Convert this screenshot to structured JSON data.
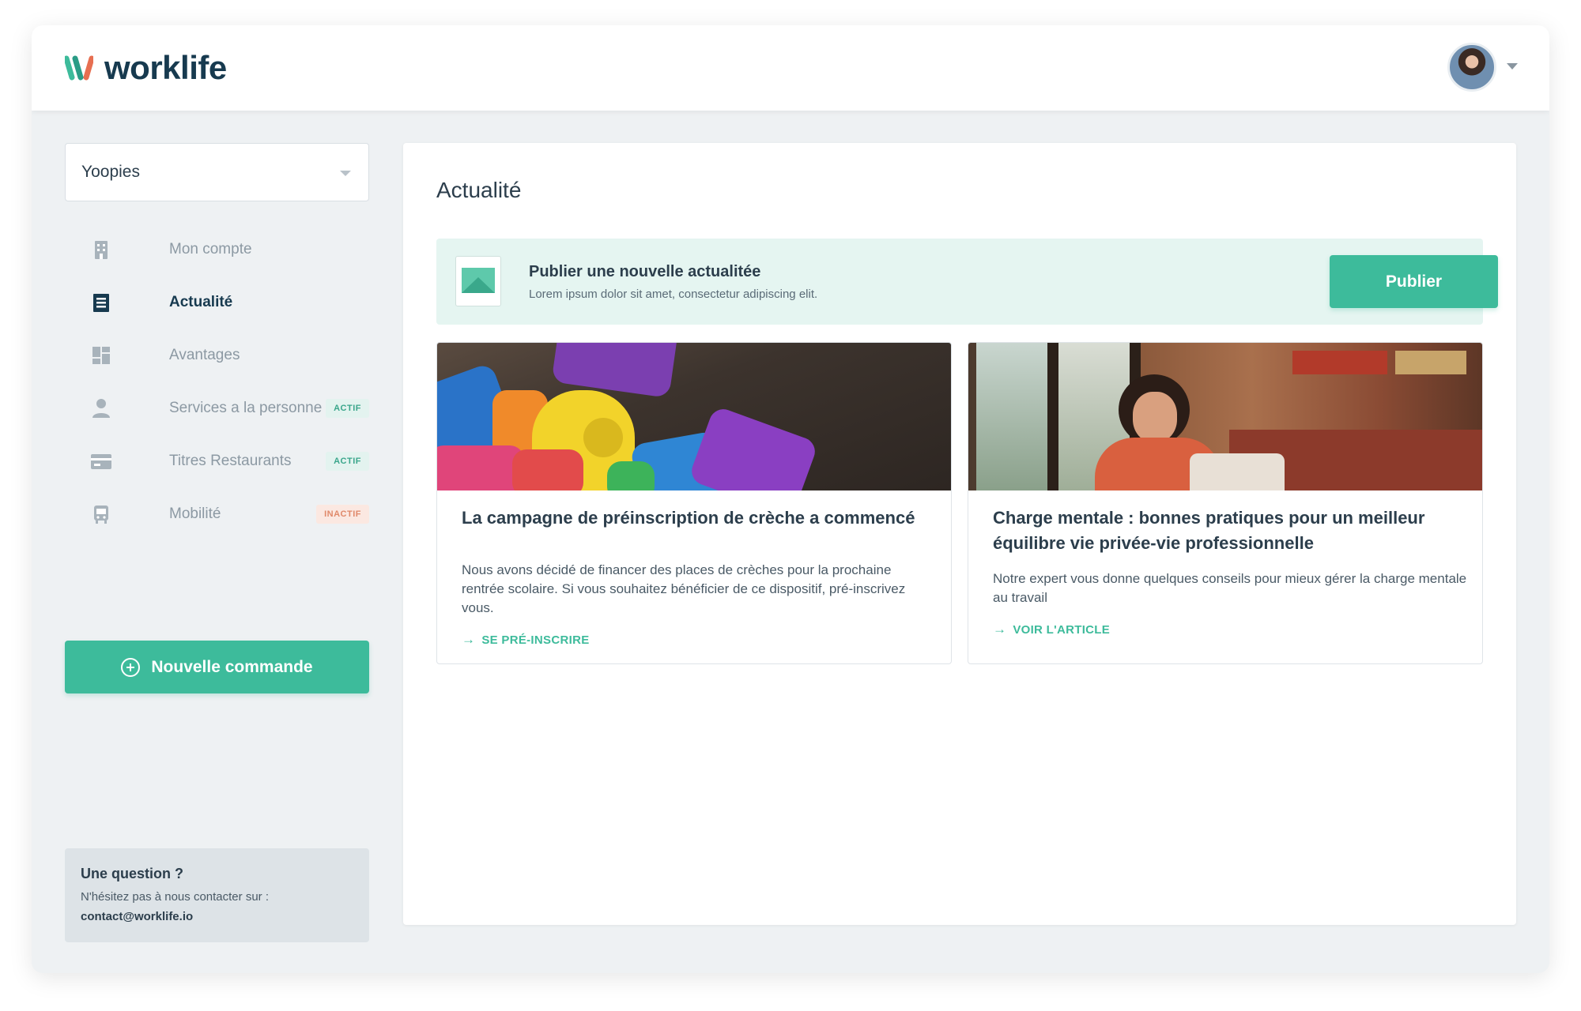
{
  "header": {
    "brand": "worklife",
    "colors": {
      "brand_dark": "#173a4f",
      "accent": "#3dbb9b"
    }
  },
  "sidebar": {
    "company": "Yoopies",
    "items": [
      {
        "label": "Mon compte",
        "icon": "building-icon",
        "active": false
      },
      {
        "label": "Actualité",
        "icon": "news-icon",
        "active": true
      },
      {
        "label": "Avantages",
        "icon": "dashboard-icon",
        "active": false
      },
      {
        "label": "Services a la personne",
        "icon": "person-icon",
        "active": false,
        "badge": "ACTIF"
      },
      {
        "label": "Titres Restaurants",
        "icon": "card-icon",
        "active": false,
        "badge": "ACTIF"
      },
      {
        "label": "Mobilité",
        "icon": "bus-icon",
        "active": false,
        "badge": "INACTIF"
      }
    ],
    "new_order": "Nouvelle commande",
    "help": {
      "title": "Une question ?",
      "text": "N'hésitez pas à nous contacter sur :",
      "email": "contact@worklife.io"
    }
  },
  "main": {
    "title": "Actualité",
    "publish": {
      "title": "Publier une nouvelle actualitée",
      "subtitle": "Lorem ipsum dolor sit amet, consectetur adipiscing elit.",
      "button": "Publier"
    },
    "cards": [
      {
        "title": "La campagne de préinscription de crèche a commencé",
        "body": "Nous avons décidé de financer des places de crèches pour la prochaine rentrée scolaire. Si vous souhaitez bénéficier de ce dispositif, pré-inscrivez vous.",
        "link": "SE PRÉ-INSCRIRE"
      },
      {
        "title": "Charge mentale : bonnes pratiques pour un meilleur équilibre vie privée-vie professionnelle",
        "body": "Notre expert vous donne quelques conseils pour mieux gérer la charge mentale au travail",
        "link": "VOIR L'ARTICLE"
      }
    ]
  }
}
